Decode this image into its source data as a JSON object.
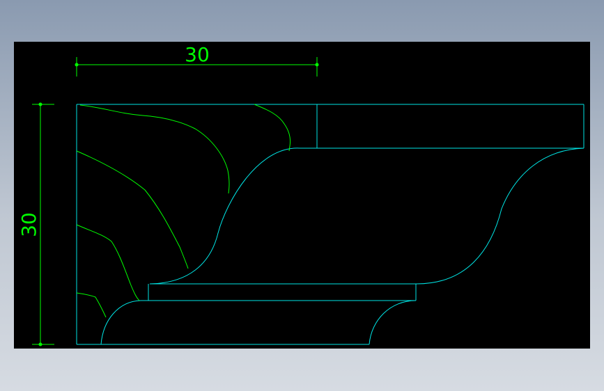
{
  "drawing": {
    "dimensions": {
      "horizontal": "30",
      "vertical": "30"
    },
    "colors": {
      "background": "#000000",
      "profile_outline": "#00e5e5",
      "dimension_lines": "#00ff00",
      "leaf_carving": "#00ff00",
      "window_frame": "#8a9ab0"
    }
  }
}
